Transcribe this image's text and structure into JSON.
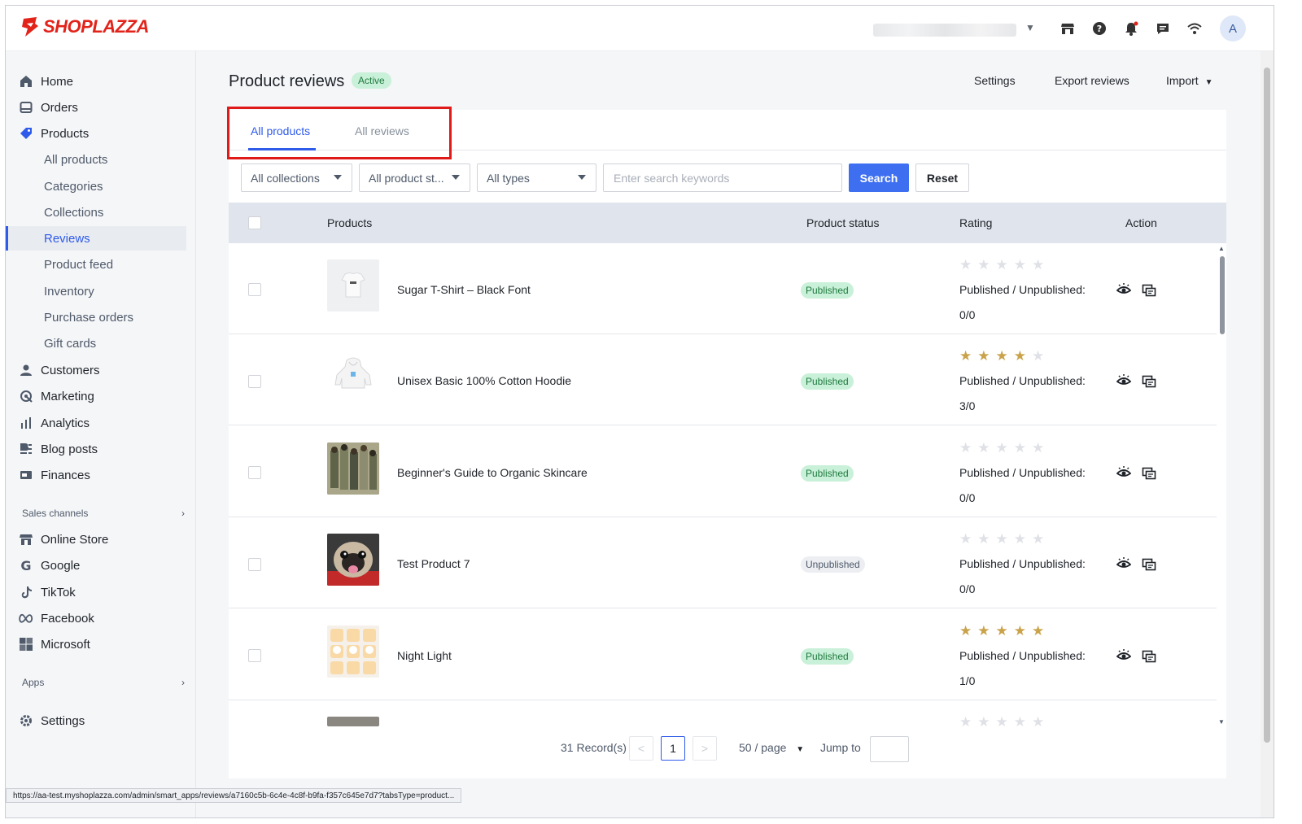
{
  "app": {
    "logo_text": "SHOPLAZZA",
    "avatar_initial": "A"
  },
  "topbar": {
    "icons": [
      "store-icon",
      "help-icon",
      "bell-icon",
      "chat-icon",
      "wifi-icon"
    ]
  },
  "sidebar": {
    "items": [
      {
        "label": "Home",
        "icon": "home-icon"
      },
      {
        "label": "Orders",
        "icon": "orders-icon"
      },
      {
        "label": "Products",
        "icon": "tag-icon"
      },
      {
        "label": "Customers",
        "icon": "person-icon"
      },
      {
        "label": "Marketing",
        "icon": "marketing-icon"
      },
      {
        "label": "Analytics",
        "icon": "bar-chart-icon"
      },
      {
        "label": "Blog posts",
        "icon": "blog-icon"
      },
      {
        "label": "Finances",
        "icon": "finance-icon"
      }
    ],
    "product_subitems": [
      "All products",
      "Categories",
      "Collections",
      "Reviews",
      "Product feed",
      "Inventory",
      "Purchase orders",
      "Gift cards"
    ],
    "sales_channels_label": "Sales channels",
    "channels": [
      {
        "label": "Online Store",
        "icon": "store-icon"
      },
      {
        "label": "Google",
        "icon": "google-icon"
      },
      {
        "label": "TikTok",
        "icon": "tiktok-icon"
      },
      {
        "label": "Facebook",
        "icon": "meta-icon"
      },
      {
        "label": "Microsoft",
        "icon": "microsoft-icon"
      }
    ],
    "apps_label": "Apps",
    "settings_label": "Settings"
  },
  "header": {
    "title": "Product reviews",
    "badge": "Active",
    "actions": {
      "settings": "Settings",
      "export": "Export reviews",
      "import": "Import"
    }
  },
  "tabs": {
    "all_products": "All products",
    "all_reviews": "All reviews"
  },
  "filters": {
    "collections": "All collections",
    "product_status": "All product st...",
    "types": "All types",
    "search_placeholder": "Enter search keywords",
    "search_button": "Search",
    "reset_button": "Reset"
  },
  "table": {
    "columns": {
      "products": "Products",
      "status": "Product status",
      "rating": "Rating",
      "action": "Action"
    },
    "rows": [
      {
        "name": "Sugar T-Shirt – Black Font",
        "status": "Published",
        "stars": 0,
        "pub_label": "Published / Unpublished:",
        "counts": "0/0",
        "thumb": "tshirt"
      },
      {
        "name": "Unisex Basic 100% Cotton Hoodie",
        "status": "Published",
        "stars": 4,
        "pub_label": "Published / Unpublished:",
        "counts": "3/0",
        "thumb": "hoodie"
      },
      {
        "name": "Beginner's Guide to Organic Skincare",
        "status": "Published",
        "stars": 0,
        "pub_label": "Published / Unpublished:",
        "counts": "0/0",
        "thumb": "people"
      },
      {
        "name": "Test Product 7",
        "status": "Unpublished",
        "stars": 0,
        "pub_label": "Published / Unpublished:",
        "counts": "0/0",
        "thumb": "pug"
      },
      {
        "name": "Night Light",
        "status": "Published",
        "stars": 5,
        "pub_label": "Published / Unpublished:",
        "counts": "1/0",
        "thumb": "lights"
      },
      {
        "name": "",
        "status": "",
        "stars": 0,
        "pub_label": "",
        "counts": "",
        "thumb": "partial"
      }
    ]
  },
  "pagination": {
    "records": "31 Record(s)",
    "current_page": "1",
    "page_size": "50 / page",
    "jump_label": "Jump to",
    "prev": "<",
    "next": ">"
  },
  "statusbar": {
    "url": "https://aa-test.myshoplazza.com/admin/smart_apps/reviews/a7160c5b-6c4e-4c8f-b9fa-f357c645e7d7?tabsType=product..."
  },
  "colors": {
    "accent": "#2f5bea",
    "brand": "#e2231a",
    "star": "#c9a24a",
    "published_bg": "#c9f0d8",
    "highlight": "#e01919"
  }
}
